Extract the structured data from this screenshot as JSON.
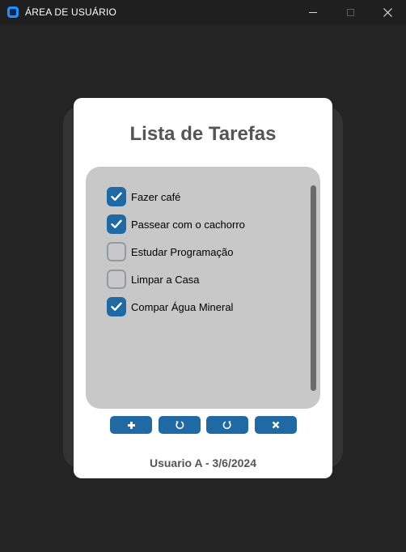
{
  "window": {
    "title": "ÁREA DE USUÁRIO"
  },
  "card": {
    "title": "Lista de Tarefas",
    "footer": "Usuario A - 3/6/2024"
  },
  "tasks": [
    {
      "label": "Fazer café",
      "checked": true
    },
    {
      "label": "Passear com o cachorro",
      "checked": true
    },
    {
      "label": "Estudar Programação",
      "checked": false
    },
    {
      "label": "Limpar a Casa",
      "checked": false
    },
    {
      "label": "Compar Água Mineral",
      "checked": true
    }
  ],
  "actions": [
    {
      "name": "add-task-button",
      "icon": "plus-icon"
    },
    {
      "name": "undo-button",
      "icon": "undo-icon"
    },
    {
      "name": "redo-button",
      "icon": "redo-icon"
    },
    {
      "name": "delete-task-button",
      "icon": "close-icon"
    }
  ],
  "colors": {
    "accent": "#1f6aa5",
    "panel": "#c8c8c8",
    "background": "#242424"
  }
}
